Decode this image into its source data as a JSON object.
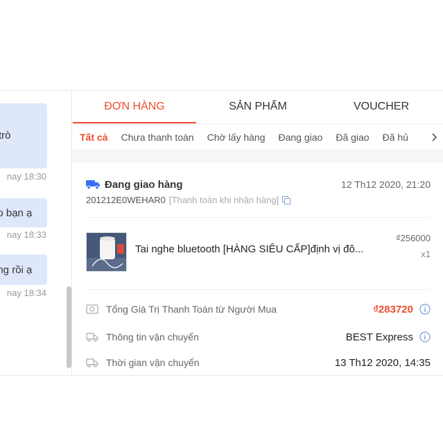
{
  "chat": {
    "messages": [
      {
        "text": "trò",
        "time": "nay 18:30"
      },
      {
        "text": "ao bạn ạ",
        "time": "nay 18:33"
      },
      {
        "text": "ang rồi ạ",
        "time": "nay 18:34"
      }
    ]
  },
  "tabs": [
    "ĐƠN HÀNG",
    "SẢN PHẨM",
    "VOUCHER"
  ],
  "subtabs": [
    "Tất cả",
    "Chưa thanh toán",
    "Chờ lấy hàng",
    "Đang giao",
    "Đã giao",
    "Đã hủ"
  ],
  "order": {
    "status": "Đang giao hàng",
    "date": "12 Th12 2020, 21:20",
    "id": "201212E0WEHAR0",
    "payment": "[Thanh toán khi nhận hàng]",
    "product": {
      "name": "Tai nghe bluetooth [HÀNG SIÊU CẤP]định vị đô...",
      "price": "₫256000",
      "qty": "x1"
    },
    "total_label": "Tổng Giá Trị Thanh Toán từ Người Mua",
    "total_value": "₫283720",
    "shipping_label": "Thông tin vận chuyển",
    "shipping_value": "BEST Express",
    "shipping_time_label": "Thời gian vận chuyển",
    "shipping_time_value": "13 Th12 2020, 14:35"
  },
  "colors": {
    "accent": "#ee4d2d",
    "bubble": "#dfe8fb",
    "truck": "#3b6ff5"
  }
}
